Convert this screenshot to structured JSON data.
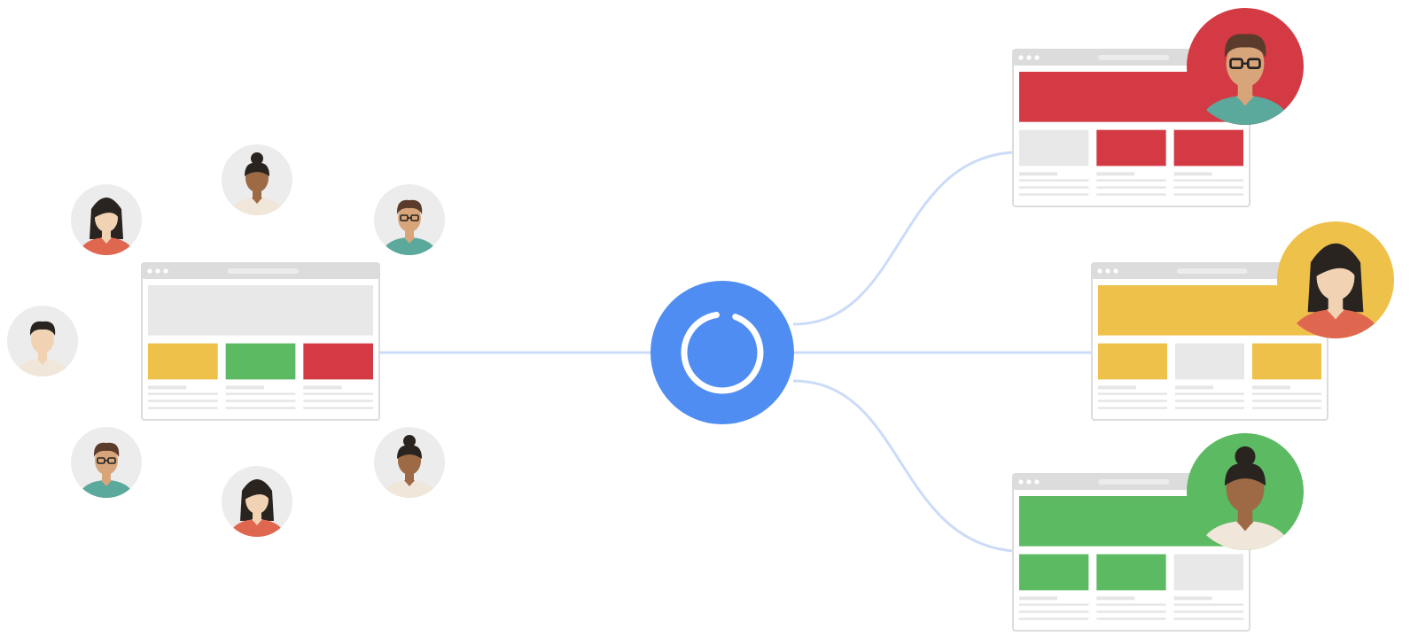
{
  "colors": {
    "background": "#ffffff",
    "connector": "#cbdcf8",
    "hub": "#4f8df2",
    "hub_ring": "#ffffff",
    "browser_frame": "#dcdcdc",
    "browser_body": "#ffffff",
    "placeholder": "#e8e8e8",
    "text_line": "#e6e6e6",
    "yellow": "#eec14b",
    "green": "#5cba62",
    "red": "#d33a44",
    "avatar_bg": "#ececec",
    "skin_light": "#f1d2b3",
    "skin_medium": "#d8a57a",
    "skin_dark": "#9d6a45",
    "hair_dark": "#2a2421",
    "hair_brown": "#5a3b2c",
    "shirt_teal": "#5ba89c",
    "shirt_coral": "#e0674f",
    "shirt_cream": "#f0e6d9"
  },
  "hub": {
    "icon": "refresh-ring-icon",
    "ring_arc_fraction": 0.92
  },
  "source_page": {
    "icon": "browser-window-icon",
    "hero": "placeholder",
    "blocks": [
      "yellow",
      "green",
      "red"
    ]
  },
  "audience": {
    "icon": "person-avatar-icon",
    "people": [
      {
        "id": "woman-long-hair-1",
        "skin": "skin_light",
        "hair": "long",
        "shirt": "shirt_coral",
        "glasses": false
      },
      {
        "id": "woman-bun-1",
        "skin": "skin_dark",
        "hair": "bun",
        "shirt": "shirt_cream",
        "glasses": false
      },
      {
        "id": "man-glasses-1",
        "skin": "skin_medium",
        "hair": "short",
        "shirt": "shirt_teal",
        "glasses": true
      },
      {
        "id": "man-short-hair",
        "skin": "skin_light",
        "hair": "short",
        "shirt": "shirt_cream",
        "glasses": false
      },
      {
        "id": "man-glasses-2",
        "skin": "skin_medium",
        "hair": "short",
        "shirt": "shirt_teal",
        "glasses": true
      },
      {
        "id": "woman-long-hair-2",
        "skin": "skin_light",
        "hair": "long",
        "shirt": "shirt_coral",
        "glasses": false
      },
      {
        "id": "woman-bun-2",
        "skin": "skin_dark",
        "hair": "bun",
        "shirt": "shirt_cream",
        "glasses": false
      }
    ]
  },
  "variants": [
    {
      "id": "variant-red",
      "accent": "red",
      "hero": "red",
      "blocks": [
        "placeholder",
        "red",
        "red"
      ],
      "persona": {
        "bg": "red",
        "skin": "skin_medium",
        "hair": "short",
        "shirt": "shirt_teal",
        "glasses": true
      }
    },
    {
      "id": "variant-yellow",
      "accent": "yellow",
      "hero": "yellow",
      "blocks": [
        "yellow",
        "placeholder",
        "yellow"
      ],
      "persona": {
        "bg": "yellow",
        "skin": "skin_light",
        "hair": "long",
        "shirt": "shirt_coral",
        "glasses": false
      }
    },
    {
      "id": "variant-green",
      "accent": "green",
      "hero": "green",
      "blocks": [
        "green",
        "green",
        "placeholder"
      ],
      "persona": {
        "bg": "green",
        "skin": "skin_dark",
        "hair": "bun",
        "shirt": "shirt_cream",
        "glasses": false
      }
    }
  ]
}
